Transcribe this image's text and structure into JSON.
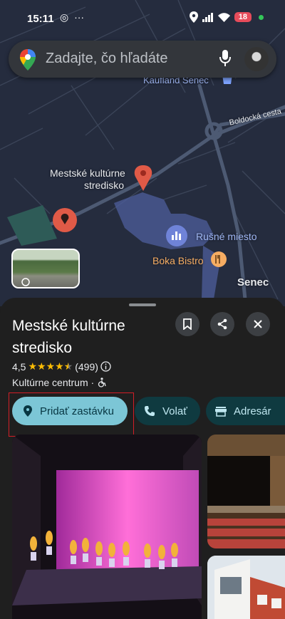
{
  "status_bar": {
    "time": "15:11",
    "battery": "18",
    "icons": [
      "whatsapp-icon",
      "more-icon",
      "location-icon",
      "signal-icon",
      "wifi-icon"
    ]
  },
  "search": {
    "placeholder": "Zadajte, čo hľadáte"
  },
  "map": {
    "labels": {
      "kaufland": "Kaufland Senec",
      "boldocka": "Boldocká cesta",
      "place_line1": "Mestské kultúrne",
      "place_line2": "stredisko",
      "rusne_miesto": "Rušné miesto",
      "boka_bistro": "Boka Bistro",
      "senec": "Senec"
    }
  },
  "place": {
    "title_line1": "Mestské kultúrne",
    "title_line2": "stredisko",
    "rating": "4,5",
    "stars": 4.5,
    "review_count": "(499)",
    "category": "Kultúrne centrum ·"
  },
  "actions": {
    "add_stop": "Pridať zastávku",
    "call": "Volať",
    "directory": "Adresár"
  },
  "colors": {
    "accent": "#7cc6d6",
    "chip_dark": "#0f3a40",
    "highlight_box": "#d21e27",
    "star": "#fbbc04",
    "map_pin": "#e05a47"
  }
}
